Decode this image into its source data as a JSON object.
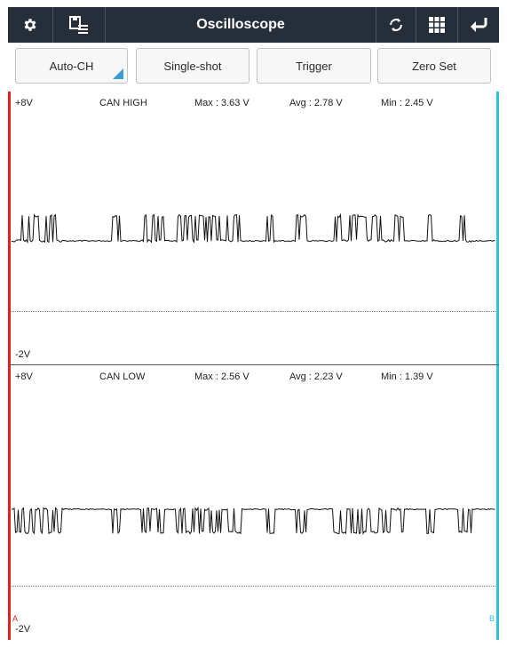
{
  "header": {
    "title": "Oscilloscope",
    "icons": [
      "gear-icon",
      "save-list-icon",
      "refresh-icon",
      "grid-icon",
      "back-icon"
    ]
  },
  "toolbar": {
    "auto_ch": "Auto-CH",
    "single_shot": "Single-shot",
    "trigger": "Trigger",
    "zero_set": "Zero Set"
  },
  "channels": [
    {
      "name": "CAN HIGH",
      "top_scale": "+8V",
      "bottom_scale": "-2V",
      "max": "Max : 3.63 V",
      "avg": "Avg : 2.78 V",
      "min": "Min : 2.45 V"
    },
    {
      "name": "CAN LOW",
      "top_scale": "+8V",
      "bottom_scale": "-2V",
      "max": "Max : 2.56 V",
      "avg": "Avg : 2.23 V",
      "min": "Min : 1.39 V"
    }
  ],
  "markers": {
    "a": "A",
    "b": "B"
  },
  "colors": {
    "header_bg": "#262f39",
    "marker_a": "#e61e1e",
    "marker_b": "#2ec4d6",
    "accent": "#3b9bd6"
  }
}
